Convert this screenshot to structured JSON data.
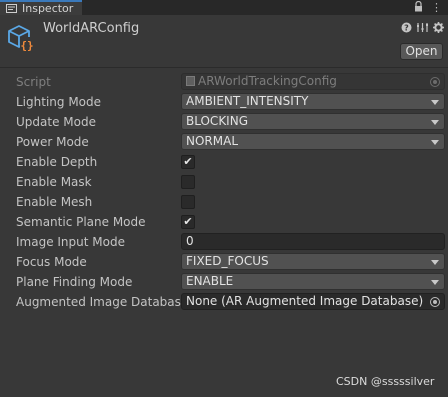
{
  "tab": {
    "label": "Inspector"
  },
  "header": {
    "title": "WorldARConfig",
    "open_label": "Open"
  },
  "fields": {
    "script": {
      "label": "Script",
      "value": "ARWorldTrackingConfig"
    },
    "lighting_mode": {
      "label": "Lighting Mode",
      "value": "AMBIENT_INTENSITY"
    },
    "update_mode": {
      "label": "Update Mode",
      "value": "BLOCKING"
    },
    "power_mode": {
      "label": "Power Mode",
      "value": "NORMAL"
    },
    "enable_depth": {
      "label": "Enable Depth",
      "checked": true
    },
    "enable_mask": {
      "label": "Enable Mask",
      "checked": false
    },
    "enable_mesh": {
      "label": "Enable Mesh",
      "checked": false
    },
    "semantic_plane_mode": {
      "label": "Semantic Plane Mode",
      "checked": true
    },
    "image_input_mode": {
      "label": "Image Input Mode",
      "value": "0"
    },
    "focus_mode": {
      "label": "Focus Mode",
      "value": "FIXED_FOCUS"
    },
    "plane_finding_mode": {
      "label": "Plane Finding Mode",
      "value": "ENABLE"
    },
    "augmented_image_database": {
      "label": "Augmented Image Database",
      "value": "None (AR Augmented Image Database)"
    }
  },
  "watermark": "CSDN @sssssilver",
  "colors": {
    "tab_accent": "#3a79bb",
    "icon_blue": "#5aa8e6",
    "icon_orange": "#f08a3c",
    "background": "#383838"
  },
  "icons": [
    "inspector-tab-icon",
    "lock-icon",
    "menu-icon",
    "scriptable-object-icon",
    "help-icon",
    "preset-icon",
    "settings-icon",
    "object-target-icon",
    "dropdown-arrow-icon",
    "checkmark-icon"
  ]
}
